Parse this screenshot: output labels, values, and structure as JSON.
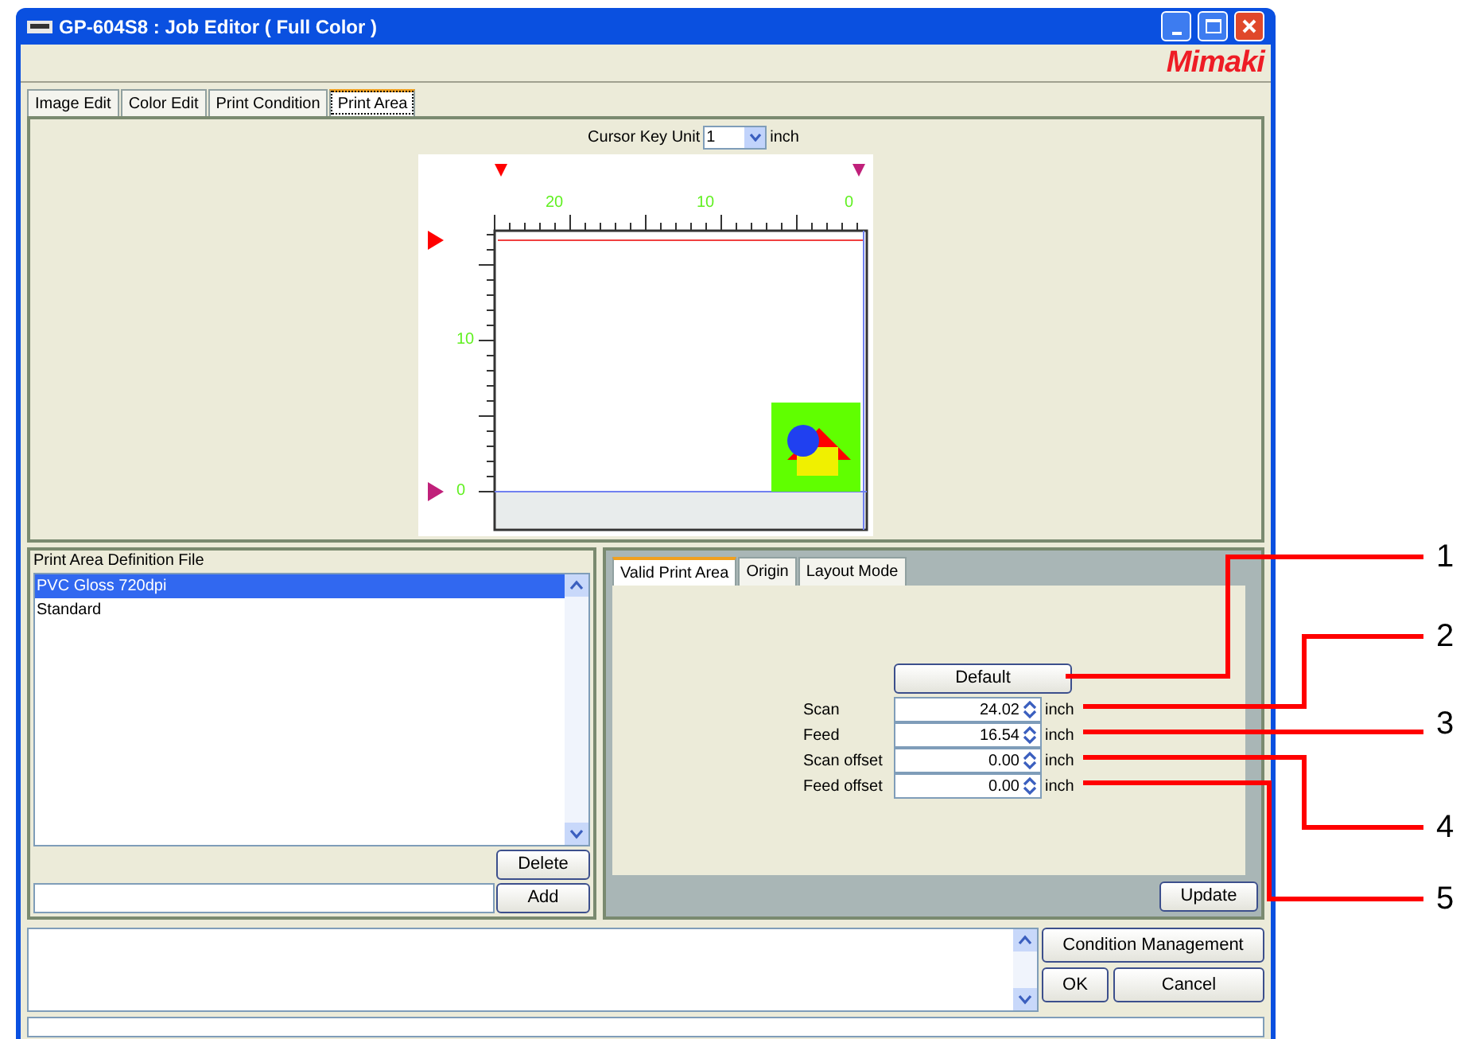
{
  "window": {
    "title": "GP-604S8 : Job Editor ( Full Color )",
    "logo": "Mimaki"
  },
  "tabs": [
    {
      "label": "Image Edit",
      "selected": false
    },
    {
      "label": "Color Edit",
      "selected": false
    },
    {
      "label": "Print Condition",
      "selected": false
    },
    {
      "label": "Print Area",
      "selected": true
    }
  ],
  "cursor_key_unit": {
    "label": "Cursor Key Unit",
    "value": "1",
    "unit": "inch"
  },
  "preview": {
    "top_ruler_labels": [
      "20",
      "10",
      "0"
    ],
    "left_ruler_labels": [
      "10",
      "0"
    ]
  },
  "definition_file": {
    "title": "Print Area Definition File",
    "items": [
      {
        "label": "PVC Gloss 720dpi",
        "selected": true
      },
      {
        "label": "Standard",
        "selected": false
      }
    ],
    "delete_button": "Delete",
    "add_button": "Add"
  },
  "sub_tabs": [
    {
      "label": "Valid Print Area",
      "selected": true
    },
    {
      "label": "Origin",
      "selected": false
    },
    {
      "label": "Layout Mode",
      "selected": false
    }
  ],
  "default_button": "Default",
  "fields": [
    {
      "label": "Scan",
      "value": "24.02",
      "unit": "inch"
    },
    {
      "label": "Feed",
      "value": "16.54",
      "unit": "inch"
    },
    {
      "label": "Scan offset",
      "value": "0.00",
      "unit": "inch"
    },
    {
      "label": "Feed offset",
      "value": "0.00",
      "unit": "inch"
    }
  ],
  "update_button": "Update",
  "bottom_buttons": {
    "condition": "Condition Management",
    "ok": "OK",
    "cancel": "Cancel"
  },
  "callouts": [
    "1",
    "2",
    "3",
    "4",
    "5"
  ]
}
